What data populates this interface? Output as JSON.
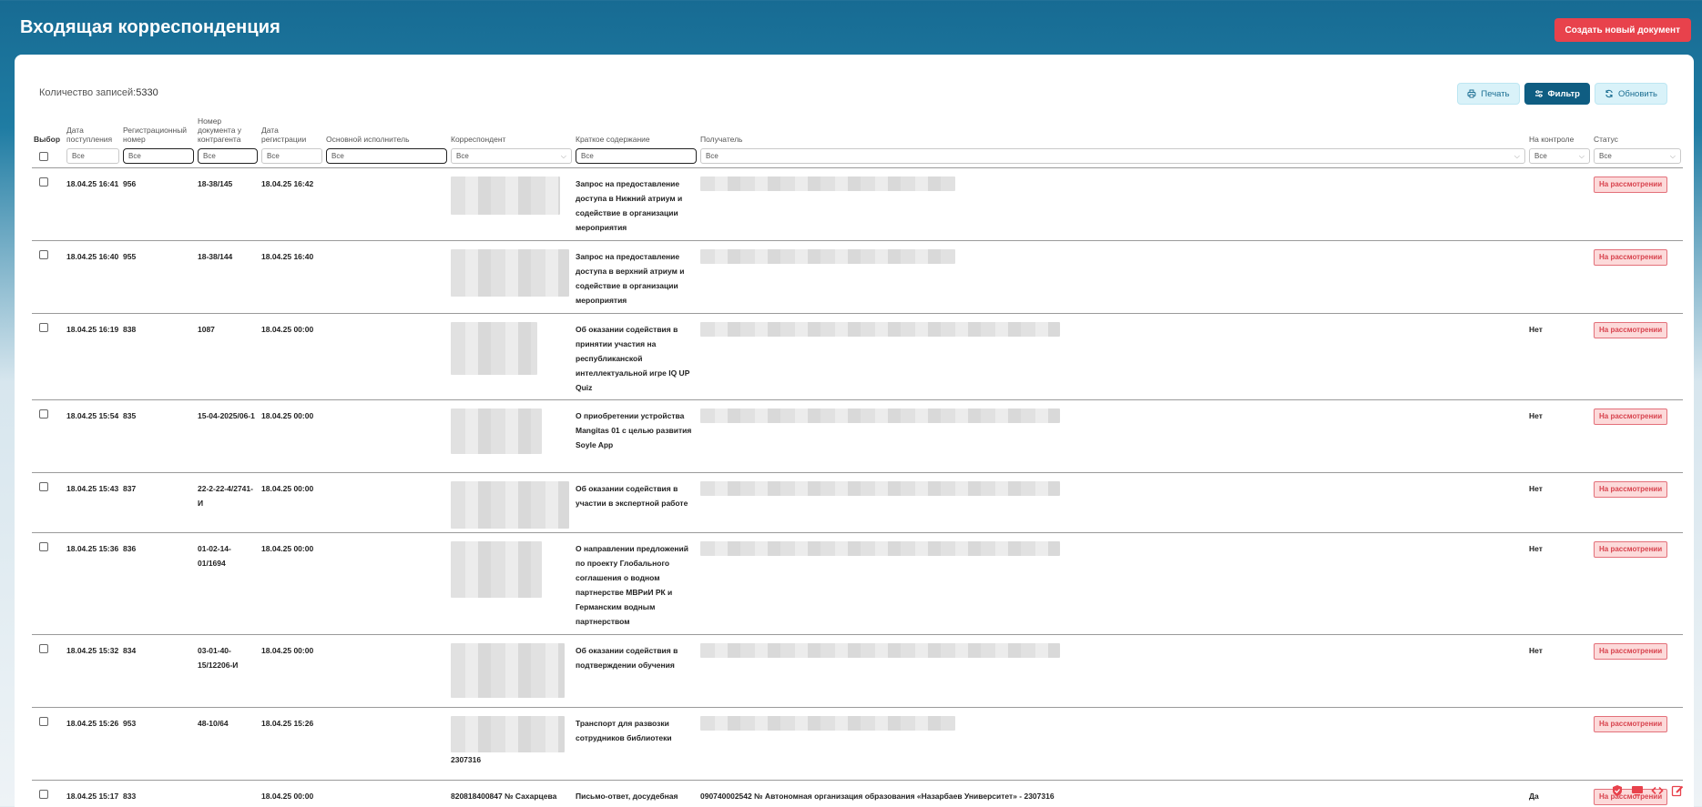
{
  "header": {
    "title": "Входящая корреспонденция",
    "create_label": "Создать новый документ"
  },
  "toolbar": {
    "count_label": "Количество записей:",
    "count_value": "5330",
    "print_label": "Печать",
    "filter_label": "Фильтр",
    "refresh_label": "Обновить"
  },
  "columns": {
    "select": "Выбор",
    "arrival_date": "Дата поступления",
    "reg_number": "Регистрационный номер",
    "contractor_doc_number": "Номер документа у контрагента",
    "reg_date": "Дата регистрации",
    "executor": "Основной исполнитель",
    "correspondent": "Корреспондент",
    "summary": "Краткое содержание",
    "recipient": "Получатель",
    "on_control": "На контроле",
    "status": "Статус"
  },
  "filters": {
    "placeholder": "Все"
  },
  "rows": [
    {
      "arrival": "18.04.25 16:41",
      "reg": "956",
      "doc": "18-38/145",
      "regdate": "18.04.25 16:42",
      "summary": "Запрос на предоставление доступа в Нижний атриум и содействие в организации мероприятия",
      "control": "",
      "status": "На рассмотрении"
    },
    {
      "arrival": "18.04.25 16:40",
      "reg": "955",
      "doc": "18-38/144",
      "regdate": "18.04.25 16:40",
      "summary": "Запрос на предоставление доступа в верхний атриум и содействие в организации мероприятия",
      "control": "",
      "status": "На рассмотрении"
    },
    {
      "arrival": "18.04.25 16:19",
      "reg": "838",
      "doc": "1087",
      "regdate": "18.04.25 00:00",
      "summary": "Об оказании содействия в принятии участия на республиканской интеллектуальной игре IQ UP Quiz",
      "control": "Нет",
      "status": "На рассмотрении"
    },
    {
      "arrival": "18.04.25 15:54",
      "reg": "835",
      "doc": "15-04-2025/06-1",
      "regdate": "18.04.25 00:00",
      "summary": "О приобретении устройства Mangitas 01 с целью развития Soyle App",
      "control": "Нет",
      "status": "На рассмотрении"
    },
    {
      "arrival": "18.04.25 15:43",
      "reg": "837",
      "doc": "22-2-22-4/2741-И",
      "regdate": "18.04.25 00:00",
      "summary": "Об оказании содействия в участии в экспертной работе",
      "control": "Нет",
      "status": "На рассмотрении"
    },
    {
      "arrival": "18.04.25 15:36",
      "reg": "836",
      "doc": "01-02-14-01/1694",
      "regdate": "18.04.25 00:00",
      "summary": "О направлении предложений по проекту Глобального соглашения о водном партнерстве МВРиИ РК и Германским водным партнерством",
      "control": "Нет",
      "status": "На рассмотрении"
    },
    {
      "arrival": "18.04.25 15:32",
      "reg": "834",
      "doc": "03-01-40-15/12206-И",
      "regdate": "18.04.25 00:00",
      "summary": "Об оказании содействия в подтверждении обучения",
      "control": "Нет",
      "status": "На рассмотрении"
    },
    {
      "arrival": "18.04.25 15:26",
      "reg": "953",
      "doc": "48-10/64",
      "regdate": "18.04.25 15:26",
      "summary": "Транспорт для развозки сотрудников библиотеки",
      "control": "",
      "status": "На рассмотрении"
    },
    {
      "arrival": "18.04.25 15:17",
      "reg": "833",
      "doc": "",
      "regdate": "18.04.25 00:00",
      "summary": "Письмо-ответ, досудебная",
      "control": "Да",
      "status": "На рассмотрении"
    }
  ],
  "row_extras": {
    "row8_corr_tail": "2307316",
    "row9_correspondent": "820818400847 № Сахарцева",
    "row9_recipient": "090740002542 № Автономная организация образования «Назарбаев Университет» - 2307316"
  },
  "icons": [
    "print-icon",
    "filter-icon",
    "refresh-icon",
    "shield-icon",
    "monitor-icon",
    "code-icon",
    "edit-icon"
  ]
}
